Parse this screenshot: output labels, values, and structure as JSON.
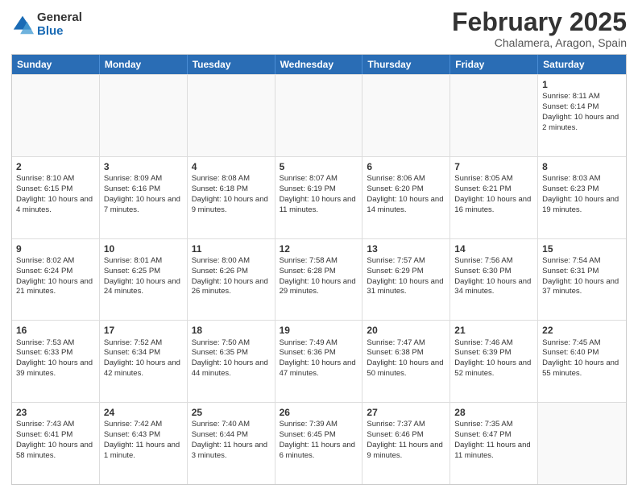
{
  "logo": {
    "general": "General",
    "blue": "Blue"
  },
  "header": {
    "month": "February 2025",
    "location": "Chalamera, Aragon, Spain"
  },
  "days": [
    "Sunday",
    "Monday",
    "Tuesday",
    "Wednesday",
    "Thursday",
    "Friday",
    "Saturday"
  ],
  "weeks": [
    [
      {
        "day": "",
        "text": ""
      },
      {
        "day": "",
        "text": ""
      },
      {
        "day": "",
        "text": ""
      },
      {
        "day": "",
        "text": ""
      },
      {
        "day": "",
        "text": ""
      },
      {
        "day": "",
        "text": ""
      },
      {
        "day": "1",
        "text": "Sunrise: 8:11 AM\nSunset: 6:14 PM\nDaylight: 10 hours and 2 minutes."
      }
    ],
    [
      {
        "day": "2",
        "text": "Sunrise: 8:10 AM\nSunset: 6:15 PM\nDaylight: 10 hours and 4 minutes."
      },
      {
        "day": "3",
        "text": "Sunrise: 8:09 AM\nSunset: 6:16 PM\nDaylight: 10 hours and 7 minutes."
      },
      {
        "day": "4",
        "text": "Sunrise: 8:08 AM\nSunset: 6:18 PM\nDaylight: 10 hours and 9 minutes."
      },
      {
        "day": "5",
        "text": "Sunrise: 8:07 AM\nSunset: 6:19 PM\nDaylight: 10 hours and 11 minutes."
      },
      {
        "day": "6",
        "text": "Sunrise: 8:06 AM\nSunset: 6:20 PM\nDaylight: 10 hours and 14 minutes."
      },
      {
        "day": "7",
        "text": "Sunrise: 8:05 AM\nSunset: 6:21 PM\nDaylight: 10 hours and 16 minutes."
      },
      {
        "day": "8",
        "text": "Sunrise: 8:03 AM\nSunset: 6:23 PM\nDaylight: 10 hours and 19 minutes."
      }
    ],
    [
      {
        "day": "9",
        "text": "Sunrise: 8:02 AM\nSunset: 6:24 PM\nDaylight: 10 hours and 21 minutes."
      },
      {
        "day": "10",
        "text": "Sunrise: 8:01 AM\nSunset: 6:25 PM\nDaylight: 10 hours and 24 minutes."
      },
      {
        "day": "11",
        "text": "Sunrise: 8:00 AM\nSunset: 6:26 PM\nDaylight: 10 hours and 26 minutes."
      },
      {
        "day": "12",
        "text": "Sunrise: 7:58 AM\nSunset: 6:28 PM\nDaylight: 10 hours and 29 minutes."
      },
      {
        "day": "13",
        "text": "Sunrise: 7:57 AM\nSunset: 6:29 PM\nDaylight: 10 hours and 31 minutes."
      },
      {
        "day": "14",
        "text": "Sunrise: 7:56 AM\nSunset: 6:30 PM\nDaylight: 10 hours and 34 minutes."
      },
      {
        "day": "15",
        "text": "Sunrise: 7:54 AM\nSunset: 6:31 PM\nDaylight: 10 hours and 37 minutes."
      }
    ],
    [
      {
        "day": "16",
        "text": "Sunrise: 7:53 AM\nSunset: 6:33 PM\nDaylight: 10 hours and 39 minutes."
      },
      {
        "day": "17",
        "text": "Sunrise: 7:52 AM\nSunset: 6:34 PM\nDaylight: 10 hours and 42 minutes."
      },
      {
        "day": "18",
        "text": "Sunrise: 7:50 AM\nSunset: 6:35 PM\nDaylight: 10 hours and 44 minutes."
      },
      {
        "day": "19",
        "text": "Sunrise: 7:49 AM\nSunset: 6:36 PM\nDaylight: 10 hours and 47 minutes."
      },
      {
        "day": "20",
        "text": "Sunrise: 7:47 AM\nSunset: 6:38 PM\nDaylight: 10 hours and 50 minutes."
      },
      {
        "day": "21",
        "text": "Sunrise: 7:46 AM\nSunset: 6:39 PM\nDaylight: 10 hours and 52 minutes."
      },
      {
        "day": "22",
        "text": "Sunrise: 7:45 AM\nSunset: 6:40 PM\nDaylight: 10 hours and 55 minutes."
      }
    ],
    [
      {
        "day": "23",
        "text": "Sunrise: 7:43 AM\nSunset: 6:41 PM\nDaylight: 10 hours and 58 minutes."
      },
      {
        "day": "24",
        "text": "Sunrise: 7:42 AM\nSunset: 6:43 PM\nDaylight: 11 hours and 1 minute."
      },
      {
        "day": "25",
        "text": "Sunrise: 7:40 AM\nSunset: 6:44 PM\nDaylight: 11 hours and 3 minutes."
      },
      {
        "day": "26",
        "text": "Sunrise: 7:39 AM\nSunset: 6:45 PM\nDaylight: 11 hours and 6 minutes."
      },
      {
        "day": "27",
        "text": "Sunrise: 7:37 AM\nSunset: 6:46 PM\nDaylight: 11 hours and 9 minutes."
      },
      {
        "day": "28",
        "text": "Sunrise: 7:35 AM\nSunset: 6:47 PM\nDaylight: 11 hours and 11 minutes."
      },
      {
        "day": "",
        "text": ""
      }
    ]
  ]
}
